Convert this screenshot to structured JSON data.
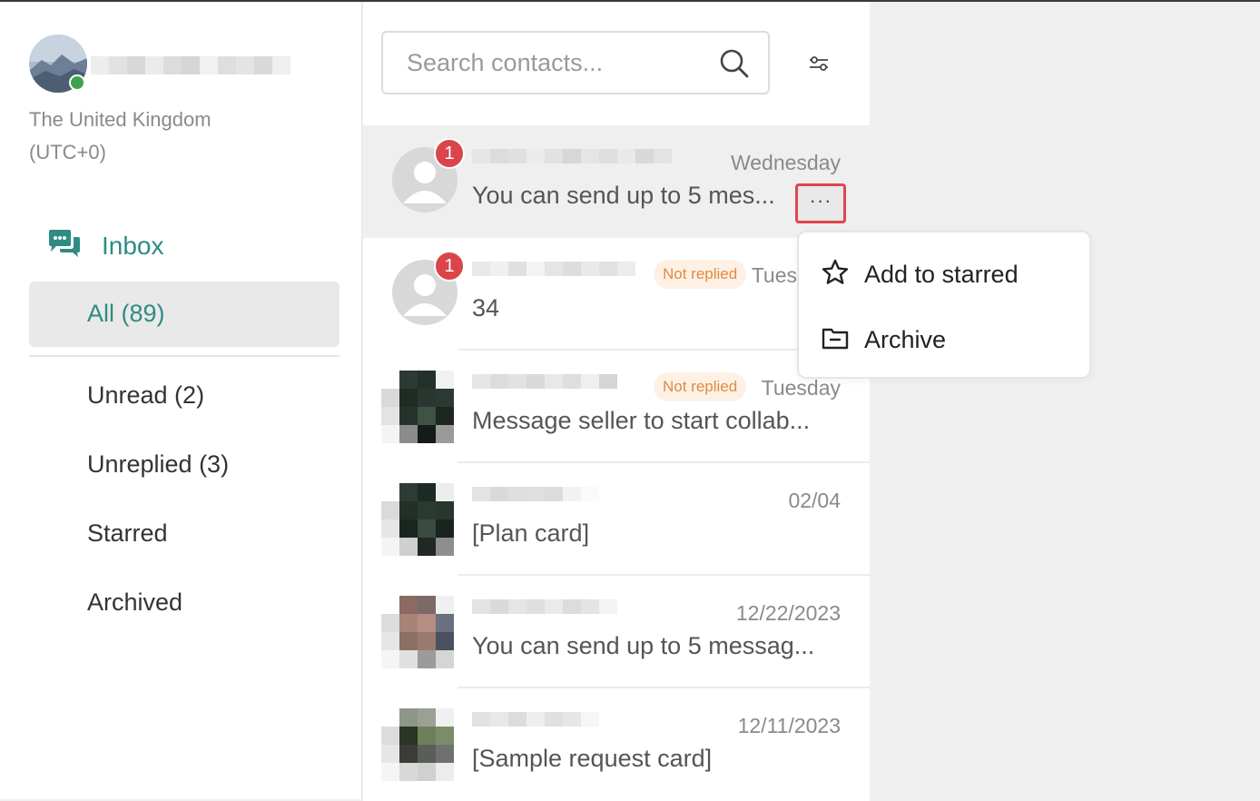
{
  "profile": {
    "region": "The United Kingdom",
    "utc_offset": "(UTC+0)",
    "status_color": "#3fa34d"
  },
  "sidebar": {
    "inbox_label": "Inbox",
    "items": [
      {
        "label": "All (89)",
        "selected": true
      },
      {
        "label": "Unread (2)"
      },
      {
        "label": "Unreplied (3)"
      },
      {
        "label": "Starred"
      },
      {
        "label": "Archived"
      }
    ]
  },
  "search": {
    "placeholder": "Search contacts...",
    "value": ""
  },
  "conversations": [
    {
      "time": "Wednesday",
      "preview": "You can send up to 5 mes...",
      "unread": "1",
      "avatar": "placeholder-icon",
      "active": true
    },
    {
      "time": "Tues",
      "preview": "34",
      "unread": "1",
      "tag": "Not replied",
      "avatar": "placeholder-icon"
    },
    {
      "time": "Tuesday",
      "preview": "Message seller to start collab...",
      "tag": "Not replied",
      "avatar": "pixelated-photo"
    },
    {
      "time": "02/04",
      "preview": "[Plan card]",
      "avatar": "pixelated-photo"
    },
    {
      "time": "12/22/2023",
      "preview": "You can send up to 5 messag...",
      "avatar": "pixelated-photo"
    },
    {
      "time": "12/11/2023",
      "preview": "[Sample request card]",
      "avatar": "pixelated-photo"
    }
  ],
  "more_button": {
    "label": "···"
  },
  "context_menu": {
    "items": [
      {
        "label": "Add to starred",
        "icon": "star-icon"
      },
      {
        "label": "Archive",
        "icon": "folder-icon"
      }
    ]
  },
  "colors": {
    "accent": "#2e8c85",
    "badge": "#d9454b",
    "tag_text": "#e08b3e",
    "tag_bg": "#fdf1e6",
    "highlight_border": "#e0454b"
  }
}
